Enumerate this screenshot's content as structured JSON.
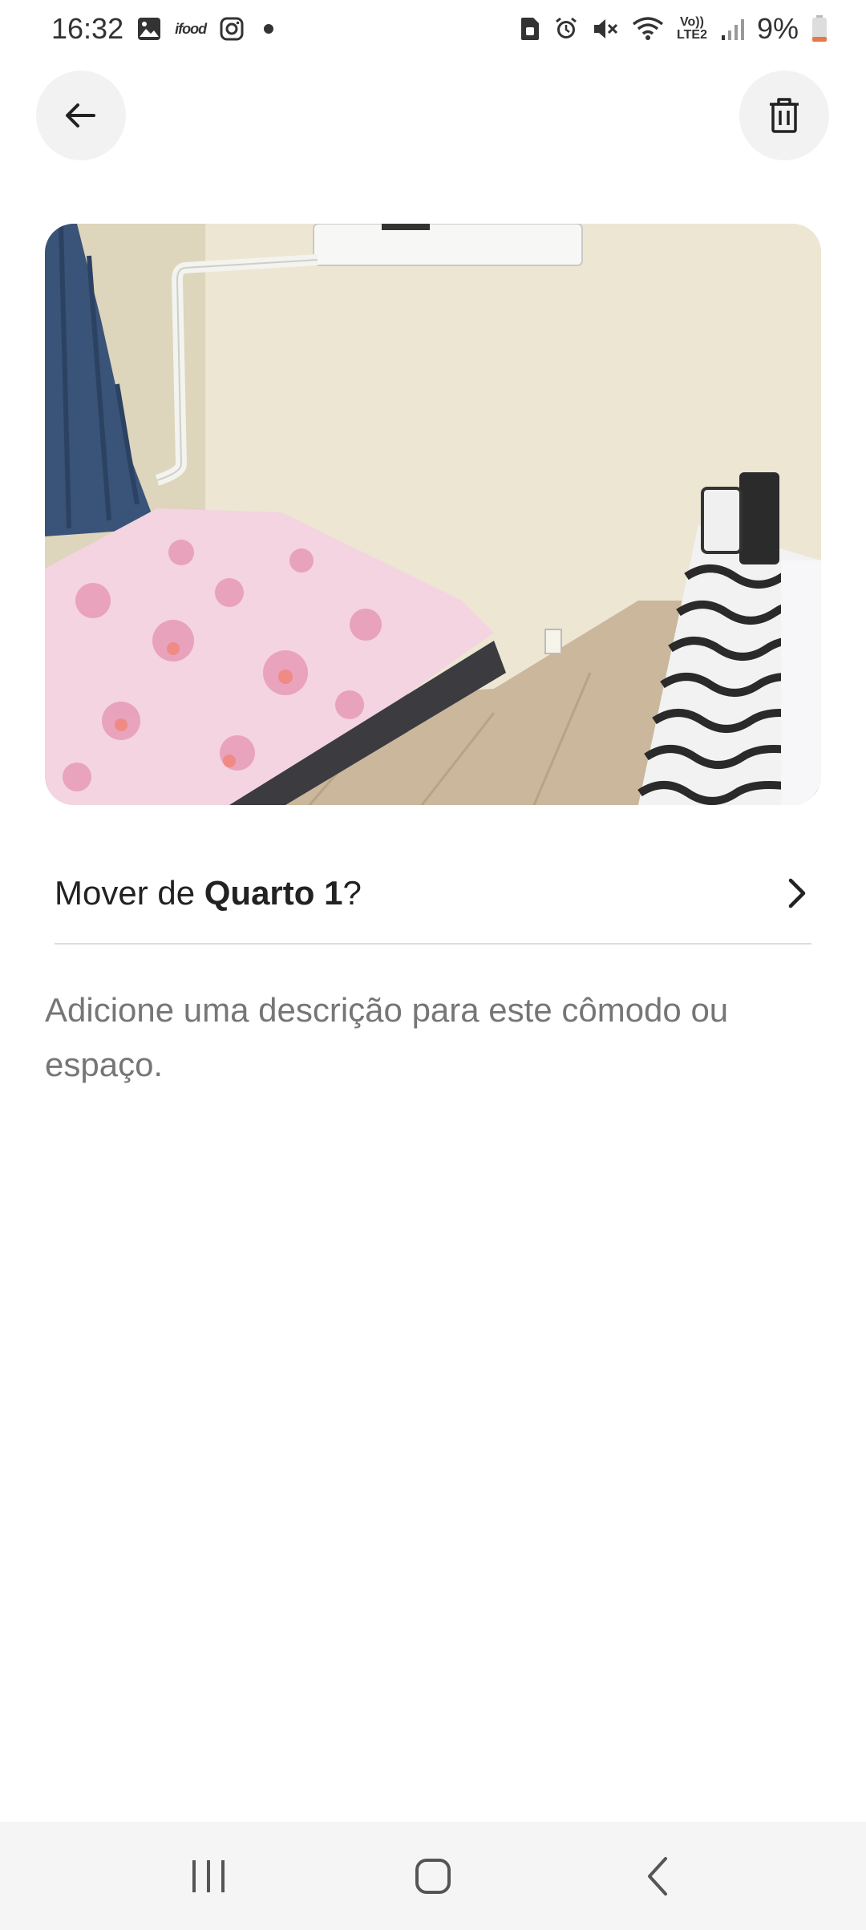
{
  "status_bar": {
    "time": "16:32",
    "ifood_label": "ifood",
    "lte_top": "Vo))",
    "lte_bottom": "LTE2",
    "battery": "9%",
    "icons": [
      "gallery-icon",
      "ifood-icon",
      "instagram-icon",
      "notification-dot",
      "sim-icon",
      "alarm-icon",
      "mute-icon",
      "wifi-icon",
      "volte-icon",
      "signal-icon",
      "battery-icon"
    ]
  },
  "header": {
    "back_icon": "arrow-left-icon",
    "delete_icon": "trash-icon"
  },
  "photo": {
    "subject": "bedroom-photo"
  },
  "move_row": {
    "prefix": "Mover de ",
    "room": "Quarto 1",
    "suffix": "?",
    "icon": "chevron-right-icon"
  },
  "description": {
    "placeholder": "Adicione uma descrição para este cômodo ou espaço."
  },
  "nav_bar": {
    "icons": [
      "recent-apps-icon",
      "home-icon",
      "back-icon"
    ]
  },
  "colors": {
    "text_primary": "#222222",
    "text_secondary": "#767676",
    "button_bg": "#f2f2f2",
    "divider": "#dddddd",
    "nav_bg": "#f5f5f5"
  }
}
